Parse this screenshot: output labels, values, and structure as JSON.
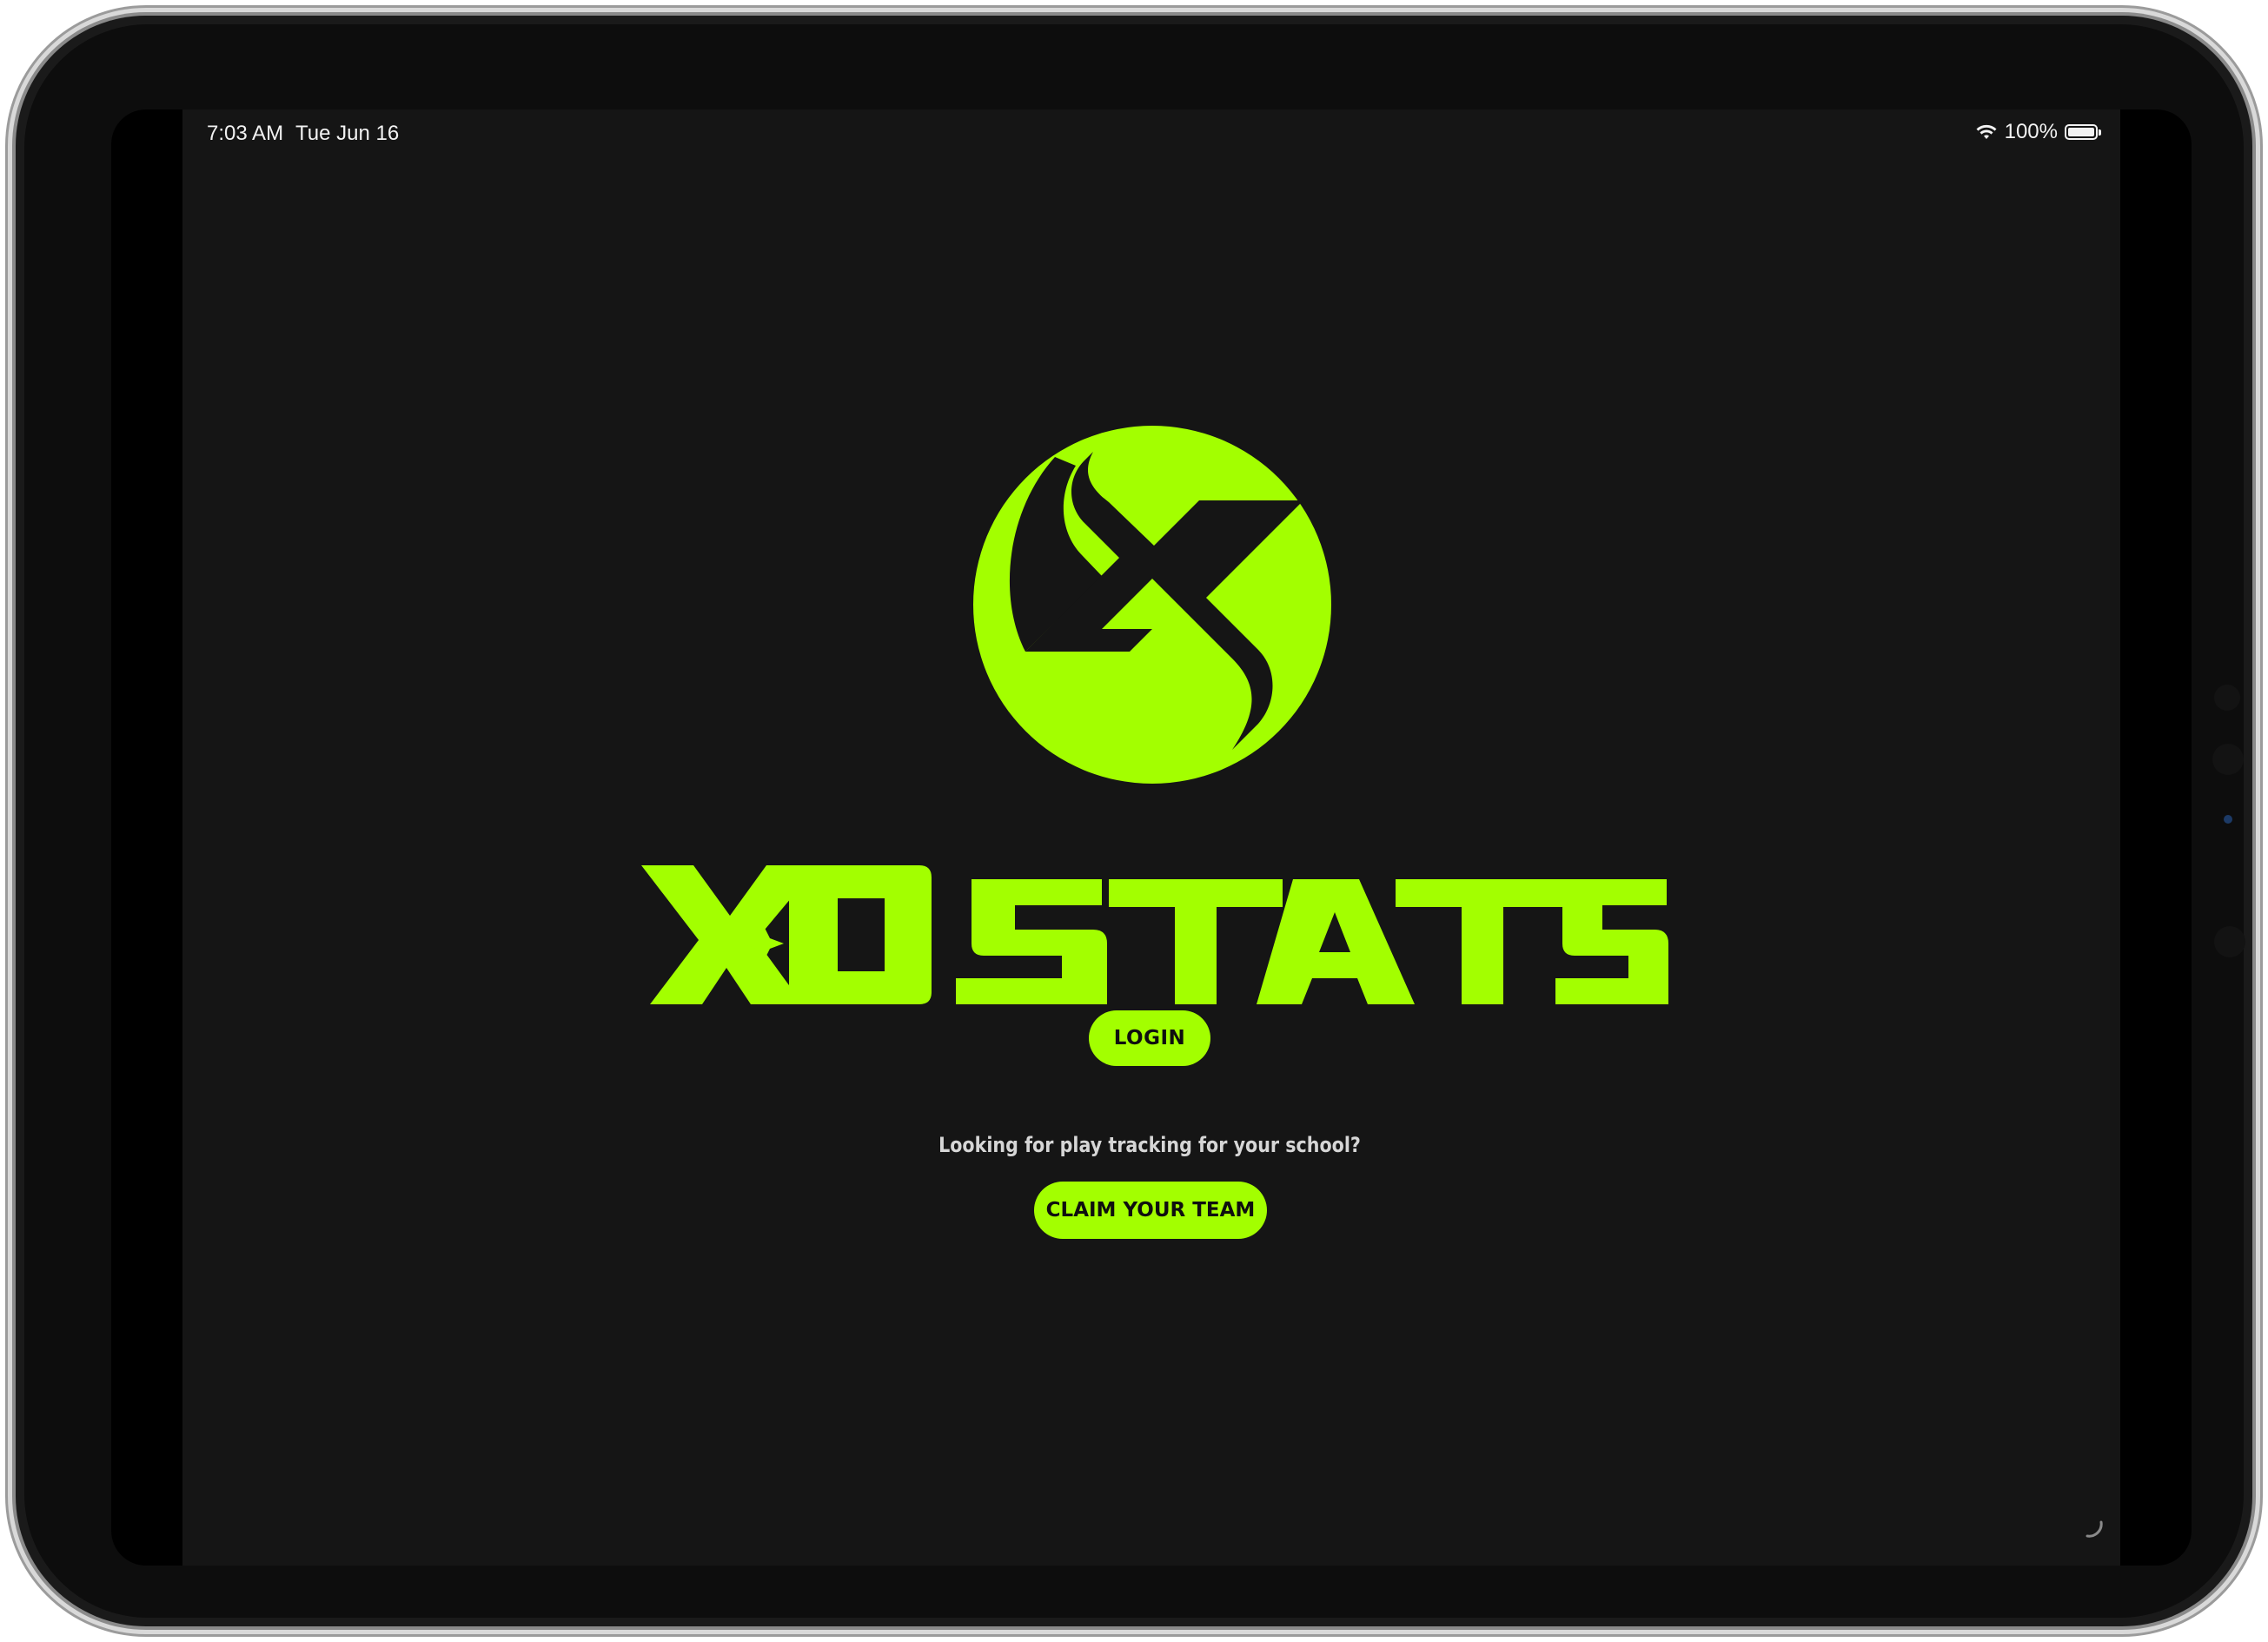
{
  "status_bar": {
    "time": "7:03 AM",
    "date": "Tue Jun 16",
    "battery_percent": "100%",
    "wifi_icon": "wifi-icon",
    "battery_icon": "battery-full-icon"
  },
  "brand": {
    "name": "XO STATS",
    "accent_color": "#a3ff00",
    "background_color": "#151515",
    "logo_icon": "xo-stats-x-logo-icon"
  },
  "login_button": {
    "label": "LOGIN"
  },
  "claim_section": {
    "prompt": "Looking for play tracking for your school?",
    "button_label": "CLAIM YOUR TEAM"
  }
}
